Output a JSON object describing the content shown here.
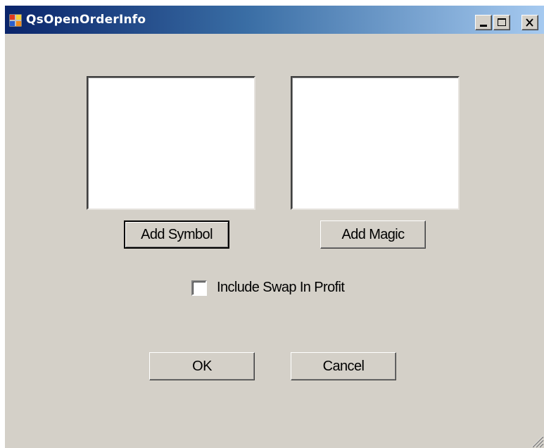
{
  "window": {
    "title": "QsOpenOrderInfo",
    "icon": "app-icon",
    "controls": {
      "minimize": "minimize-icon",
      "maximize": "maximize-icon",
      "close": "close-icon"
    }
  },
  "lists": {
    "symbols": [],
    "magics": []
  },
  "buttons": {
    "add_symbol": "Add Symbol",
    "add_magic": "Add Magic",
    "ok": "OK",
    "cancel": "Cancel"
  },
  "options": {
    "include_swap_label": "Include Swap In Profit",
    "include_swap_checked": false
  },
  "colors": {
    "face": "#d4d0c8",
    "titlebar_start": "#0a246a",
    "titlebar_end": "#a6caf0"
  }
}
